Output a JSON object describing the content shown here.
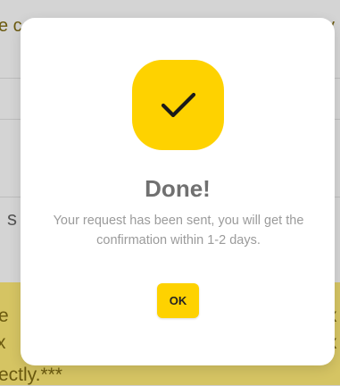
{
  "background": {
    "top_fragment_left": "e c",
    "top_fragment_right": "y",
    "side_letter_left": "s",
    "bottom_fragment_left_1": "e",
    "bottom_fragment_left_2": "x",
    "bottom_fragment_right_1": "x",
    "bottom_fragment_right_2": "x",
    "bottom_text": "ectly.***",
    "highlight_color": "#d5c463"
  },
  "dialog": {
    "icon": "checkmark-icon",
    "accent_color": "#fed200",
    "title": "Done!",
    "message": "Your request has been sent, you will get the confirmation within 1-2 days.",
    "ok_label": "OK"
  }
}
